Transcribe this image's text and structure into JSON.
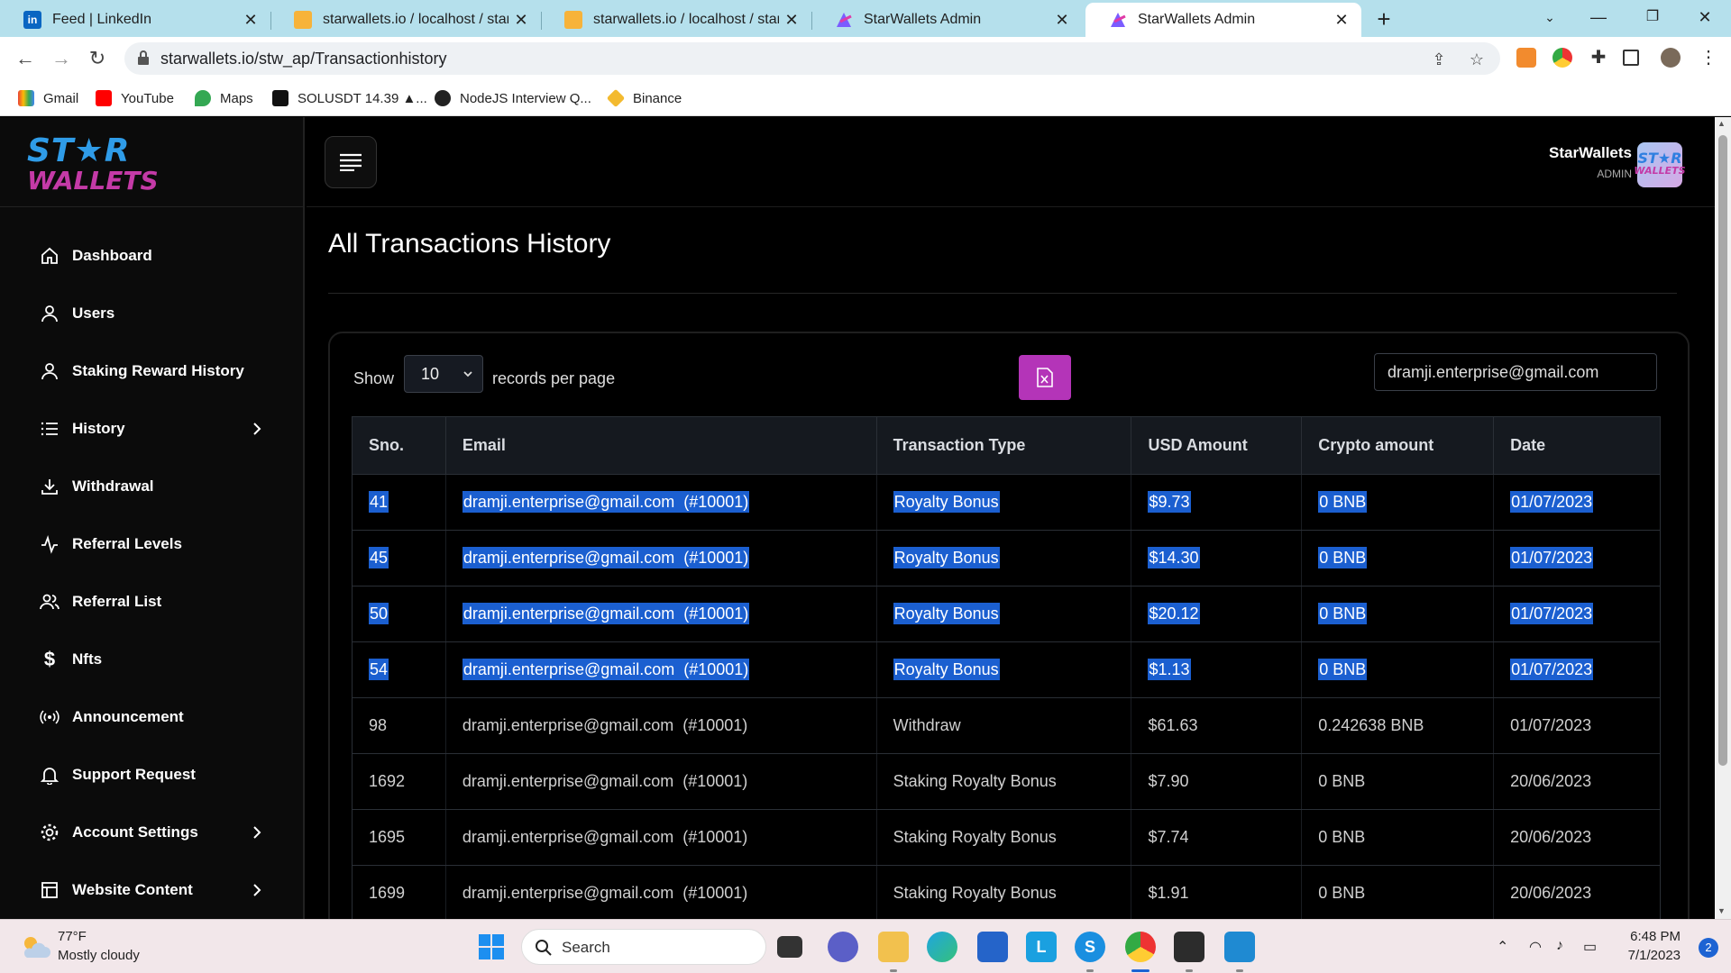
{
  "browser": {
    "tabs": [
      {
        "title": "Feed | LinkedIn",
        "icon": "linkedin-icon"
      },
      {
        "title": "starwallets.io / localhost / star_w",
        "icon": "phpmyadmin-icon"
      },
      {
        "title": "starwallets.io / localhost / star_w",
        "icon": "phpmyadmin-icon"
      },
      {
        "title": "StarWallets Admin",
        "icon": "starwallets-icon"
      },
      {
        "title": "StarWallets Admin",
        "icon": "starwallets-icon",
        "active": true
      }
    ],
    "url": "starwallets.io/stw_ap/Transactionhistory",
    "bookmarks": [
      {
        "label": "Gmail",
        "icon": "gmail-icon"
      },
      {
        "label": "YouTube",
        "icon": "youtube-icon"
      },
      {
        "label": "Maps",
        "icon": "maps-icon"
      },
      {
        "label": "SOLUSDT 14.39 ▲...",
        "icon": "tradingview-icon"
      },
      {
        "label": "NodeJS Interview Q...",
        "icon": "github-icon"
      },
      {
        "label": "Binance",
        "icon": "binance-icon"
      }
    ]
  },
  "brand": {
    "line1": "ST★R",
    "line2": "WALLETS",
    "accent": "#b434b8",
    "selection": "#1b5fd0"
  },
  "sidebar": {
    "items": [
      {
        "label": "Dashboard",
        "icon": "home-icon"
      },
      {
        "label": "Users",
        "icon": "user-icon"
      },
      {
        "label": "Staking Reward History",
        "icon": "user-icon"
      },
      {
        "label": "History",
        "icon": "list-icon",
        "expandable": true
      },
      {
        "label": "Withdrawal",
        "icon": "download-icon"
      },
      {
        "label": "Referral Levels",
        "icon": "activity-icon"
      },
      {
        "label": "Referral List",
        "icon": "users-icon"
      },
      {
        "label": "Nfts",
        "icon": "dollar-icon"
      },
      {
        "label": "Announcement",
        "icon": "broadcast-icon"
      },
      {
        "label": "Support Request",
        "icon": "bell-icon"
      },
      {
        "label": "Account Settings",
        "icon": "gear-icon",
        "expandable": true
      },
      {
        "label": "Website Content",
        "icon": "layout-icon",
        "expandable": true
      }
    ]
  },
  "header": {
    "user_name": "StarWallets",
    "user_role": "ADMIN"
  },
  "page": {
    "title": "All Transactions History"
  },
  "controls": {
    "show_label": "Show",
    "per_page": "10",
    "per_page_suffix": "records per page",
    "search_value": "dramji.enterprise@gmail.com"
  },
  "table": {
    "headers": [
      "Sno.",
      "Email",
      "Transaction Type",
      "USD Amount",
      "Crypto amount",
      "Date"
    ],
    "rows": [
      {
        "sno": "41",
        "email": "dramji.enterprise@gmail.com  (#10001)",
        "type": "Royalty Bonus",
        "usd": "$9.73",
        "crypto": "0 BNB",
        "date": "01/07/2023",
        "selected": true
      },
      {
        "sno": "45",
        "email": "dramji.enterprise@gmail.com  (#10001)",
        "type": "Royalty Bonus",
        "usd": "$14.30",
        "crypto": "0 BNB",
        "date": "01/07/2023",
        "selected": true
      },
      {
        "sno": "50",
        "email": "dramji.enterprise@gmail.com  (#10001)",
        "type": "Royalty Bonus",
        "usd": "$20.12",
        "crypto": "0 BNB",
        "date": "01/07/2023",
        "selected": true
      },
      {
        "sno": "54",
        "email": "dramji.enterprise@gmail.com  (#10001)",
        "type": "Royalty Bonus",
        "usd": "$1.13",
        "crypto": "0 BNB",
        "date": "01/07/2023",
        "selected": true
      },
      {
        "sno": "98",
        "email": "dramji.enterprise@gmail.com  (#10001)",
        "type": "Withdraw",
        "usd": "$61.63",
        "crypto": "0.242638 BNB",
        "date": "01/07/2023",
        "selected": false
      },
      {
        "sno": "1692",
        "email": "dramji.enterprise@gmail.com  (#10001)",
        "type": "Staking Royalty Bonus",
        "usd": "$7.90",
        "crypto": "0 BNB",
        "date": "20/06/2023",
        "selected": false
      },
      {
        "sno": "1695",
        "email": "dramji.enterprise@gmail.com  (#10001)",
        "type": "Staking Royalty Bonus",
        "usd": "$7.74",
        "crypto": "0 BNB",
        "date": "20/06/2023",
        "selected": false
      },
      {
        "sno": "1699",
        "email": "dramji.enterprise@gmail.com  (#10001)",
        "type": "Staking Royalty Bonus",
        "usd": "$1.91",
        "crypto": "0 BNB",
        "date": "20/06/2023",
        "selected": false
      }
    ]
  },
  "taskbar": {
    "weather_temp": "77°F",
    "weather_desc": "Mostly cloudy",
    "search_placeholder": "Search",
    "time": "6:48 PM",
    "date": "7/1/2023",
    "notifications": "2"
  }
}
